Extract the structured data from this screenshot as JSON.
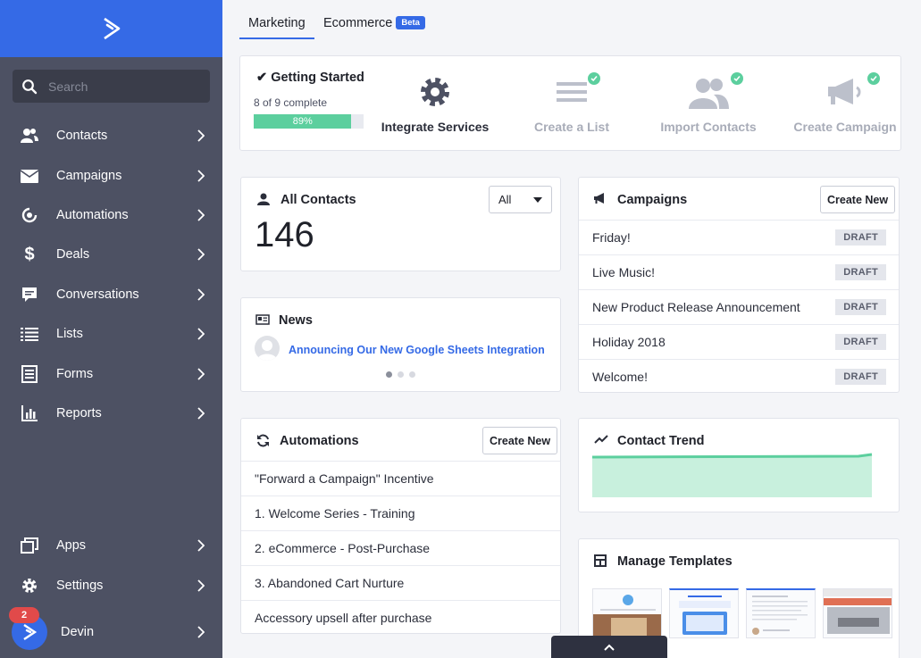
{
  "colors": {
    "brand": "#356ae6",
    "sidebar": "#4d5163",
    "success": "#5ccf9e",
    "badge": "#e14a4a"
  },
  "sidebar": {
    "search_placeholder": "Search",
    "items": [
      {
        "label": "Contacts",
        "icon": "contacts-icon"
      },
      {
        "label": "Campaigns",
        "icon": "envelope-icon"
      },
      {
        "label": "Automations",
        "icon": "automations-icon"
      },
      {
        "label": "Deals",
        "icon": "dollar-icon"
      },
      {
        "label": "Conversations",
        "icon": "chat-icon"
      },
      {
        "label": "Lists",
        "icon": "list-icon"
      },
      {
        "label": "Forms",
        "icon": "form-icon"
      },
      {
        "label": "Reports",
        "icon": "bar-chart-icon"
      },
      {
        "label": "Apps",
        "icon": "apps-icon"
      },
      {
        "label": "Settings",
        "icon": "gear-icon"
      }
    ],
    "user": {
      "name": "Devin",
      "notifications": "2"
    }
  },
  "tabs": [
    {
      "label": "Marketing",
      "active": true
    },
    {
      "label": "Ecommerce",
      "badge": "Beta"
    }
  ],
  "getting_started": {
    "title": "Getting Started",
    "subtitle": "8 of 9 complete",
    "progress": {
      "percent": 89,
      "label": "89%"
    },
    "steps": [
      {
        "label": "Integrate Services",
        "done": false,
        "icon": "gear-icon"
      },
      {
        "label": "Create a List",
        "done": true,
        "icon": "list-icon"
      },
      {
        "label": "Import Contacts",
        "done": true,
        "icon": "contacts-icon"
      },
      {
        "label": "Create Campaign",
        "done": true,
        "icon": "megaphone-icon"
      }
    ]
  },
  "all_contacts": {
    "title": "All Contacts",
    "filter": "All",
    "count": "146"
  },
  "news": {
    "title": "News",
    "headline": "Announcing Our New Google Sheets Integration"
  },
  "campaigns": {
    "title": "Campaigns",
    "create_label": "Create New",
    "items": [
      {
        "name": "Friday!",
        "status": "DRAFT"
      },
      {
        "name": "Live Music!",
        "status": "DRAFT"
      },
      {
        "name": "New Product Release Announcement",
        "status": "DRAFT"
      },
      {
        "name": "Holiday 2018",
        "status": "DRAFT"
      },
      {
        "name": "Welcome!",
        "status": "DRAFT"
      }
    ]
  },
  "automations": {
    "title": "Automations",
    "create_label": "Create New",
    "items": [
      "\"Forward a Campaign\" Incentive",
      "1. Welcome Series - Training",
      "2. eCommerce - Post-Purchase",
      "3. Abandoned Cart Nurture",
      "Accessory upsell after purchase"
    ]
  },
  "contact_trend": {
    "title": "Contact Trend"
  },
  "templates": {
    "title": "Manage Templates"
  }
}
